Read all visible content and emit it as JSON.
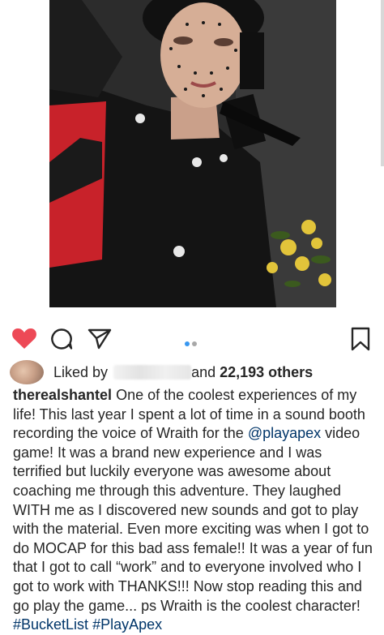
{
  "post": {
    "username": "therealshantel",
    "caption_parts": [
      "One of the coolest experiences of my life! This last year I spent a lot of time in a sound booth recording the voice of Wraith for the ",
      "@playapex",
      " video game! It was a brand new experience and I was terrified but luckily everyone was awesome about coaching me through this adventure. They laughed WITH me as I discovered new sounds and got to play with the material. Even more exciting was when I got to do MOCAP for this bad ass female!! It was a year of fun that I got to call “work” and to everyone involved who I got to work with THANKS!!! Now stop reading this and go play the game... ps Wraith is the coolest character!",
      "#BucketList",
      "#PlayApex"
    ]
  },
  "likes": {
    "prefix": "Liked by",
    "middle": "and",
    "others": "22,193 others"
  },
  "carousel": {
    "count": 2,
    "active_index": 0
  },
  "icons": {
    "like": "heart-filled-icon",
    "comment": "comment-icon",
    "share": "paper-plane-icon",
    "save": "bookmark-icon"
  },
  "colors": {
    "like_red": "#ed4956",
    "link_blue": "#003569",
    "carousel_active": "#3897f0",
    "text": "#262626"
  }
}
